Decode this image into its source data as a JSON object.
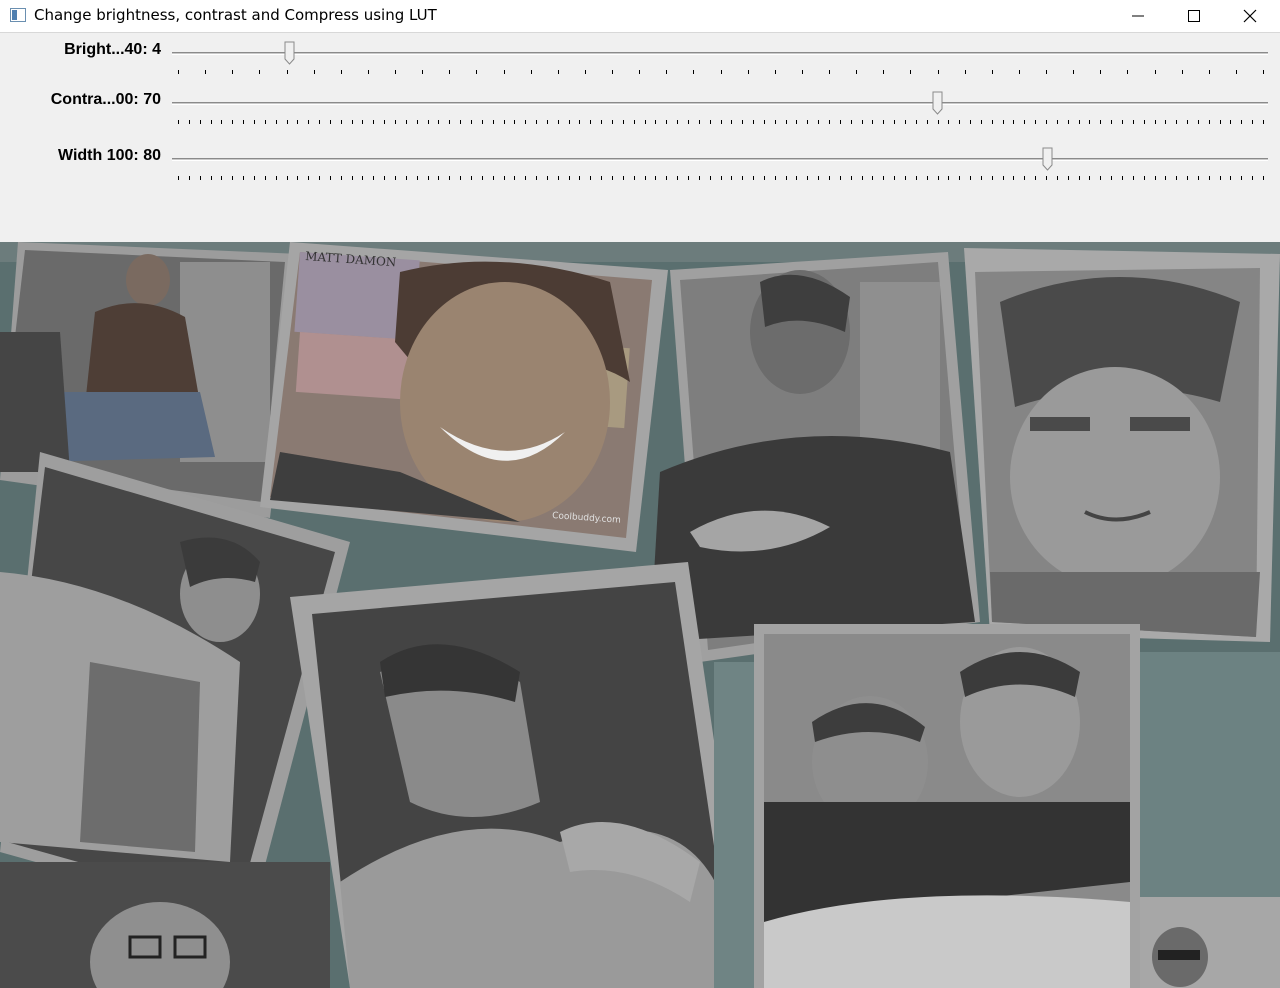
{
  "window": {
    "title": "Change brightness, contrast and Compress using LUT",
    "buttons": {
      "minimize": "minimize",
      "maximize": "maximize",
      "close": "close"
    }
  },
  "trackbars": [
    {
      "id": "brightness",
      "label": "Bright...40: 4",
      "value": 4,
      "max": 40
    },
    {
      "id": "contrast",
      "label": "Contra...00: 70",
      "value": 70,
      "max": 100
    },
    {
      "id": "width",
      "label": "Width 100: 80",
      "value": 80,
      "max": 100
    }
  ],
  "image": {
    "description_texts": [
      "MATT DAMON",
      "Coolbuddy.com"
    ]
  },
  "colors": {
    "background_teal": "#5a6f6f",
    "photo_frame": "#9a9a9a",
    "dark": "#444444",
    "mid": "#6f6f6f",
    "light": "#a9a9a9"
  }
}
